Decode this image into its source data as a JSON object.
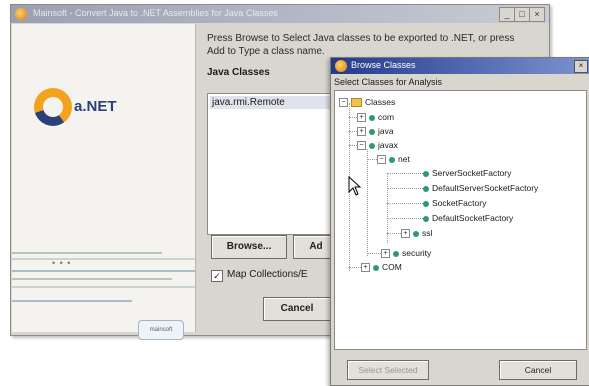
{
  "main_window": {
    "title": "Mainsoft - Convert Java to .NET Assemblies for Java Classes",
    "logo_text": "a.NET",
    "small_logo_text": "mainsoft",
    "instructions": "Press Browse to Select Java classes to be exported to .NET, or press Add to Type a class name.",
    "java_classes_header": "Java Classes",
    "class_list": [
      "java.rmi.Remote"
    ],
    "browse_label": "Browse...",
    "add_label": "Ad",
    "map_collections_label": "Map Collections/E",
    "cancel_label": "Cancel",
    "progress_dots": "• • •"
  },
  "browse_dialog": {
    "title": "Browse Classes",
    "subtitle": "Select Classes for Analysis",
    "tree": {
      "root": "Classes",
      "com": "com",
      "java": "java",
      "javax": "javax",
      "net": "net",
      "items": [
        "ServerSocketFactory",
        "DefaultServerSocketFactory",
        "SocketFactory",
        "DefaultSocketFactory"
      ],
      "ssl": "ssl",
      "security": "security",
      "corba": "COM"
    },
    "select_button": "Select Selected",
    "cancel_button": "Cancel"
  },
  "colors": {
    "dialog_titlebar": "#233a8c",
    "window_face": "#d9d6cf",
    "node_icon": "#2f9b68"
  }
}
